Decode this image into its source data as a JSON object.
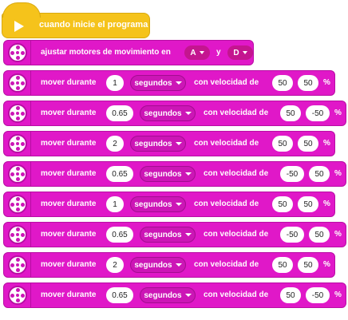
{
  "start": {
    "label": "cuando inicie el programa"
  },
  "setup": {
    "label": "ajustar motores de movimiento en",
    "port_a": "A",
    "and": "y",
    "port_b": "D"
  },
  "rows": [
    {
      "prefix": "mover durante",
      "value": "1",
      "unit": "segundos",
      "speed_label": "con velocidad de",
      "left": "50",
      "right": "50",
      "pct": "%"
    },
    {
      "prefix": "mover durante",
      "value": "0.65",
      "unit": "segundos",
      "speed_label": "con velocidad de",
      "left": "50",
      "right": "-50",
      "pct": "%"
    },
    {
      "prefix": "mover durante",
      "value": "2",
      "unit": "segundos",
      "speed_label": "con velocidad de",
      "left": "50",
      "right": "50",
      "pct": "%"
    },
    {
      "prefix": "mover durante",
      "value": "0.65",
      "unit": "segundos",
      "speed_label": "con velocidad de",
      "left": "-50",
      "right": "50",
      "pct": "%"
    },
    {
      "prefix": "mover durante",
      "value": "1",
      "unit": "segundos",
      "speed_label": "con velocidad de",
      "left": "50",
      "right": "50",
      "pct": "%"
    },
    {
      "prefix": "mover durante",
      "value": "0.65",
      "unit": "segundos",
      "speed_label": "con velocidad de",
      "left": "-50",
      "right": "50",
      "pct": "%"
    },
    {
      "prefix": "mover durante",
      "value": "2",
      "unit": "segundos",
      "speed_label": "con velocidad de",
      "left": "50",
      "right": "50",
      "pct": "%"
    },
    {
      "prefix": "mover durante",
      "value": "0.65",
      "unit": "segundos",
      "speed_label": "con velocidad de",
      "left": "50",
      "right": "-50",
      "pct": "%"
    }
  ],
  "colors": {
    "event": "#f5c31b",
    "motor": "#e018c8",
    "dropdown": "#cc16b6"
  },
  "icons": {
    "event": "play-flag-icon",
    "motor": "motor-wheel-icon",
    "dropdown": "caret-down-icon"
  }
}
